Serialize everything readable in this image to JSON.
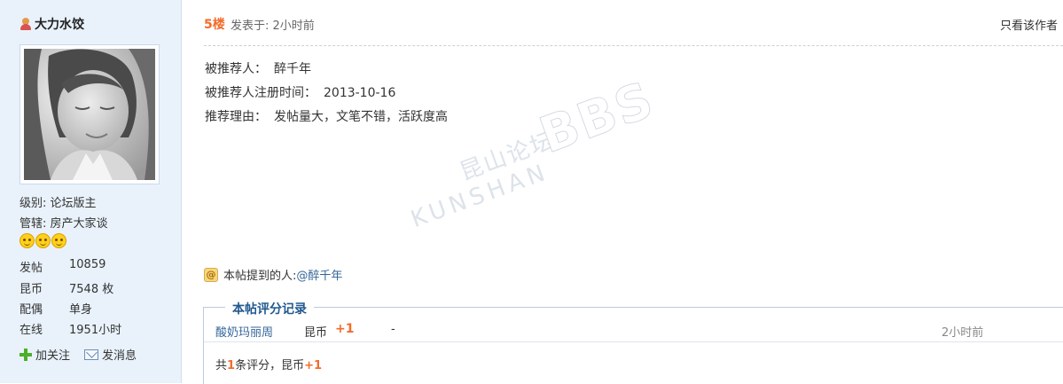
{
  "author": {
    "name": "大力水饺",
    "level": "级别: 论坛版主",
    "manages": "管辖: 房产大家谈",
    "stats": [
      {
        "label": "发帖",
        "value": "10859"
      },
      {
        "label": "昆币",
        "value": "7548 枚"
      },
      {
        "label": "配偶",
        "value": "单身"
      },
      {
        "label": "在线",
        "value": "1951小时"
      }
    ],
    "actions": {
      "follow": "加关注",
      "message": "发消息"
    }
  },
  "post": {
    "floor": "5楼",
    "posted_at": "发表于: 2小时前",
    "only_author": "只看该作者",
    "lines": [
      {
        "label": "被推荐人：",
        "value": "醉千年"
      },
      {
        "label": "被推荐人注册时间：",
        "value": "2013-10-16"
      },
      {
        "label": "推荐理由：",
        "value": "发帖量大，文笔不错，活跃度高"
      }
    ],
    "watermark": {
      "top": "昆山论坛",
      "bbs": "BBS",
      "bottom": "KUNSHAN"
    },
    "mention": {
      "label": "本帖提到的人:",
      "user": "@醉千年"
    }
  },
  "rating": {
    "title": "本帖评分记录",
    "row": {
      "user": "酸奶玛丽周",
      "type": "昆币",
      "value": "+1",
      "reason": "-",
      "time": "2小时前"
    },
    "total": {
      "prefix": "共",
      "count": "1",
      "middle": "条评分，昆币",
      "sum": "+1"
    }
  },
  "colors": {
    "accent": "#f26c2a",
    "link": "#336699",
    "sidebar_bg": "#e9f2fb"
  }
}
